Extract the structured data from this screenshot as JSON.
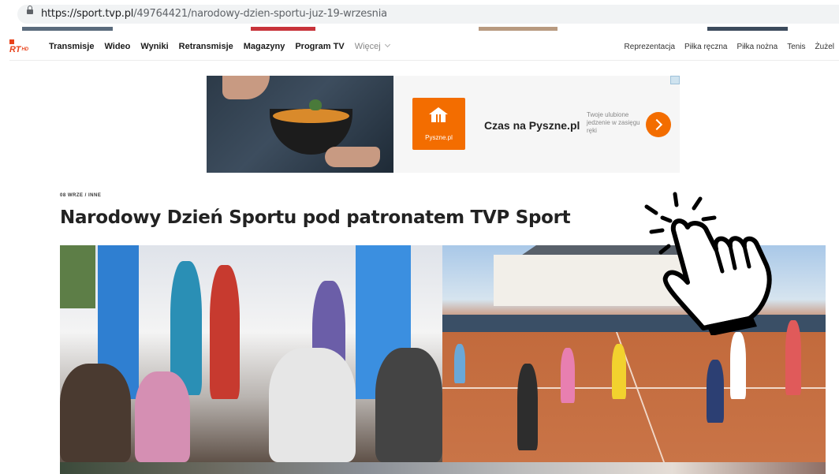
{
  "browser": {
    "url_host": "https://sport.tvp.pl",
    "url_path": "/49764421/narodowy-dzien-sportu-juz-19-wrzesnia"
  },
  "nav": {
    "logo_text": "RT",
    "logo_hd": "HD",
    "items": [
      "Transmisje",
      "Wideo",
      "Wyniki",
      "Retransmisje",
      "Magazyny",
      "Program TV"
    ],
    "more_label": "Więcej",
    "right_items": [
      "Reprezentacja",
      "Piłka ręczna",
      "Piłka nożna",
      "Tenis",
      "Żużel"
    ]
  },
  "ad": {
    "brand_label": "Pyszne.pl",
    "headline": "Czas na Pyszne.pl",
    "subtext": "Twoje ulubione jedzenie w zasięgu ręki",
    "accent_color": "#f36d00"
  },
  "article": {
    "meta": "08 WRZE / INNE",
    "title": "Narodowy Dzień Sportu pod patronatem TVP Sport"
  },
  "overlay": {
    "icon": "hand-pointer-click-icon"
  }
}
